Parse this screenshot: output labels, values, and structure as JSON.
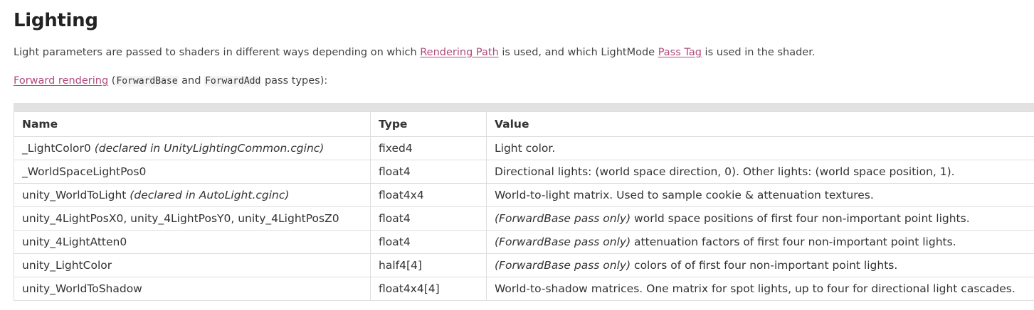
{
  "heading": "Lighting",
  "intro": {
    "text1": "Light parameters are passed to shaders in different ways depending on which ",
    "link1": "Rendering Path",
    "text2": " is used, and which LightMode ",
    "link2": "Pass Tag",
    "text3": " is used in the shader."
  },
  "forward": {
    "link": "Forward rendering",
    "paren_open": " (",
    "code1": "ForwardBase",
    "and": " and ",
    "code2": "ForwardAdd",
    "tail": " pass types):"
  },
  "table": {
    "headers": [
      "Name",
      "Type",
      "Value"
    ],
    "rows": [
      {
        "name": "_LightColor0",
        "name_note": " (declared in UnityLightingCommon.cginc)",
        "type": "fixed4",
        "value_em": "",
        "value": "Light color."
      },
      {
        "name": "_WorldSpaceLightPos0",
        "name_note": "",
        "type": "float4",
        "value_em": "",
        "value": "Directional lights: (world space direction, 0). Other lights: (world space position, 1)."
      },
      {
        "name": "unity_WorldToLight",
        "name_note": " (declared in AutoLight.cginc)",
        "type": "float4x4",
        "value_em": "",
        "value": "World-to-light matrix. Used to sample cookie & attenuation textures."
      },
      {
        "name": "unity_4LightPosX0, unity_4LightPosY0, unity_4LightPosZ0",
        "name_note": "",
        "type": "float4",
        "value_em": "(ForwardBase pass only)",
        "value": " world space positions of first four non-important point lights."
      },
      {
        "name": "unity_4LightAtten0",
        "name_note": "",
        "type": "float4",
        "value_em": "(ForwardBase pass only)",
        "value": " attenuation factors of first four non-important point lights."
      },
      {
        "name": "unity_LightColor",
        "name_note": "",
        "type": "half4[4]",
        "value_em": "(ForwardBase pass only)",
        "value": " colors of of first four non-important point lights."
      },
      {
        "name": "unity_WorldToShadow",
        "name_note": "",
        "type": "float4x4[4]",
        "value_em": "",
        "value": "World-to-shadow matrices. One matrix for spot lights, up to four for directional light cascades."
      }
    ]
  },
  "colors": {
    "link": "#b04b7e",
    "header_bar": "#e2e2e2",
    "border": "#dddddd"
  }
}
